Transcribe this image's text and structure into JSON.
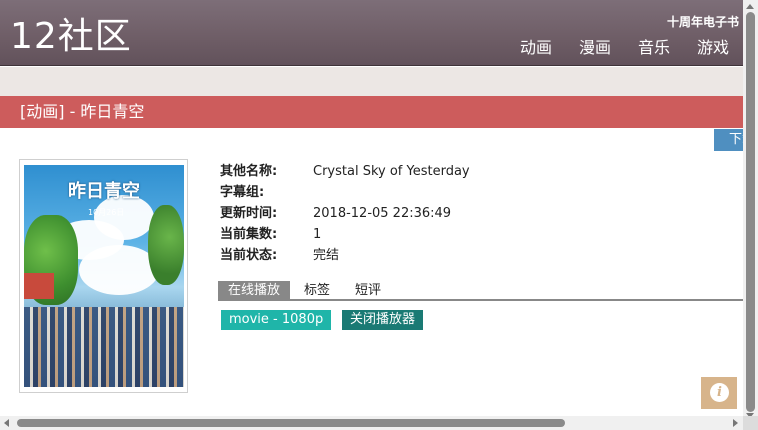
{
  "header": {
    "logo": "12社区",
    "top_link": "十周年电子书",
    "nav": [
      "动画",
      "漫画",
      "音乐",
      "游戏"
    ]
  },
  "page": {
    "title": "[动画] - 昨日青空",
    "download_label": "下载"
  },
  "poster": {
    "title_text": "昨日青空",
    "date_text": "10月26日"
  },
  "details": [
    {
      "key": "其他名称:",
      "value": "Crystal Sky of Yesterday"
    },
    {
      "key": "字幕组:",
      "value": ""
    },
    {
      "key": "更新时间:",
      "value": "2018-12-05 22:36:49"
    },
    {
      "key": "当前集数:",
      "value": "1"
    },
    {
      "key": "当前状态:",
      "value": "完结"
    }
  ],
  "tabs": [
    "在线播放",
    "标签",
    "短评"
  ],
  "player": {
    "source_label": "movie - 1080p",
    "close_label": "关闭播放器"
  },
  "colors": {
    "header": "#6e5d66",
    "title_bar": "#cd5c5c",
    "source_button": "#1fb5a9",
    "close_button": "#1a7a74",
    "download_button": "#4f8fc0",
    "info_button": "#d7b48b"
  },
  "icons": {
    "info": "info-icon"
  }
}
